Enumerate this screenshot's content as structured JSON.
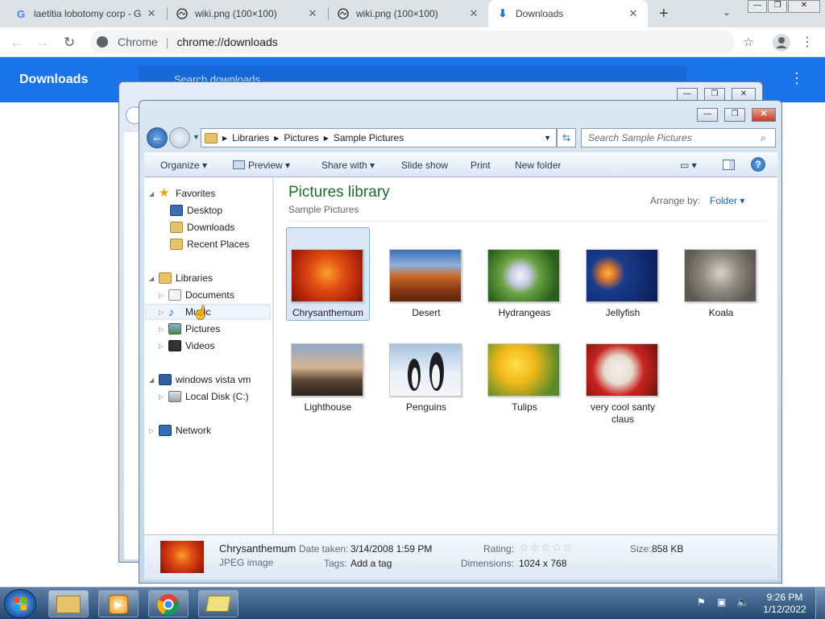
{
  "browser": {
    "tabs": [
      {
        "title": "laetitia lobotomy corp - G",
        "favicon": "G"
      },
      {
        "title": "wiki.png (100×100)",
        "favicon": "image-icon"
      },
      {
        "title": "wiki.png (100×100)",
        "favicon": "image-icon"
      },
      {
        "title": "Downloads",
        "favicon": "download-icon"
      }
    ],
    "new_tab": "+",
    "omnibox": {
      "origin": "Chrome",
      "url": "chrome://downloads"
    }
  },
  "downloads_page": {
    "title": "Downloads",
    "search_placeholder": "Search downloads"
  },
  "explorer": {
    "breadcrumb": [
      "Libraries",
      "Pictures",
      "Sample Pictures"
    ],
    "search_placeholder": "Search Sample Pictures",
    "commands": [
      "Organize",
      "Preview",
      "Share with",
      "Slide show",
      "Print",
      "New folder"
    ],
    "nav": {
      "favorites": {
        "label": "Favorites",
        "items": [
          "Desktop",
          "Downloads",
          "Recent Places"
        ]
      },
      "libraries": {
        "label": "Libraries",
        "items": [
          "Documents",
          "Music",
          "Pictures",
          "Videos"
        ]
      },
      "computer": {
        "label": "windows vista vm",
        "items": [
          "Local Disk (C:)"
        ]
      },
      "network": {
        "label": "Network"
      }
    },
    "library": {
      "title": "Pictures library",
      "subtitle": "Sample Pictures",
      "arrange_label": "Arrange by:",
      "arrange_value": "Folder"
    },
    "files": [
      "Chrysanthemum",
      "Desert",
      "Hydrangeas",
      "Jellyfish",
      "Koala",
      "Lighthouse",
      "Penguins",
      "Tulips",
      "very cool santy claus"
    ],
    "details": {
      "name": "Chrysanthemum",
      "type": "JPEG image",
      "date_label": "Date taken:",
      "date_value": "3/14/2008 1:59 PM",
      "tags_label": "Tags:",
      "tags_value": "Add a tag",
      "rating_label": "Rating:",
      "rating": 0,
      "dimensions_label": "Dimensions:",
      "dimensions_value": "1024 x 768",
      "size_label": "Size:",
      "size_value": "858 KB"
    }
  },
  "taskbar": {
    "time": "9:26 PM",
    "date": "1/12/2022"
  },
  "colors": {
    "chrome_blue": "#1a73e8",
    "library_title": "#1e6b2d",
    "nav_hover": "#eef4fb"
  }
}
